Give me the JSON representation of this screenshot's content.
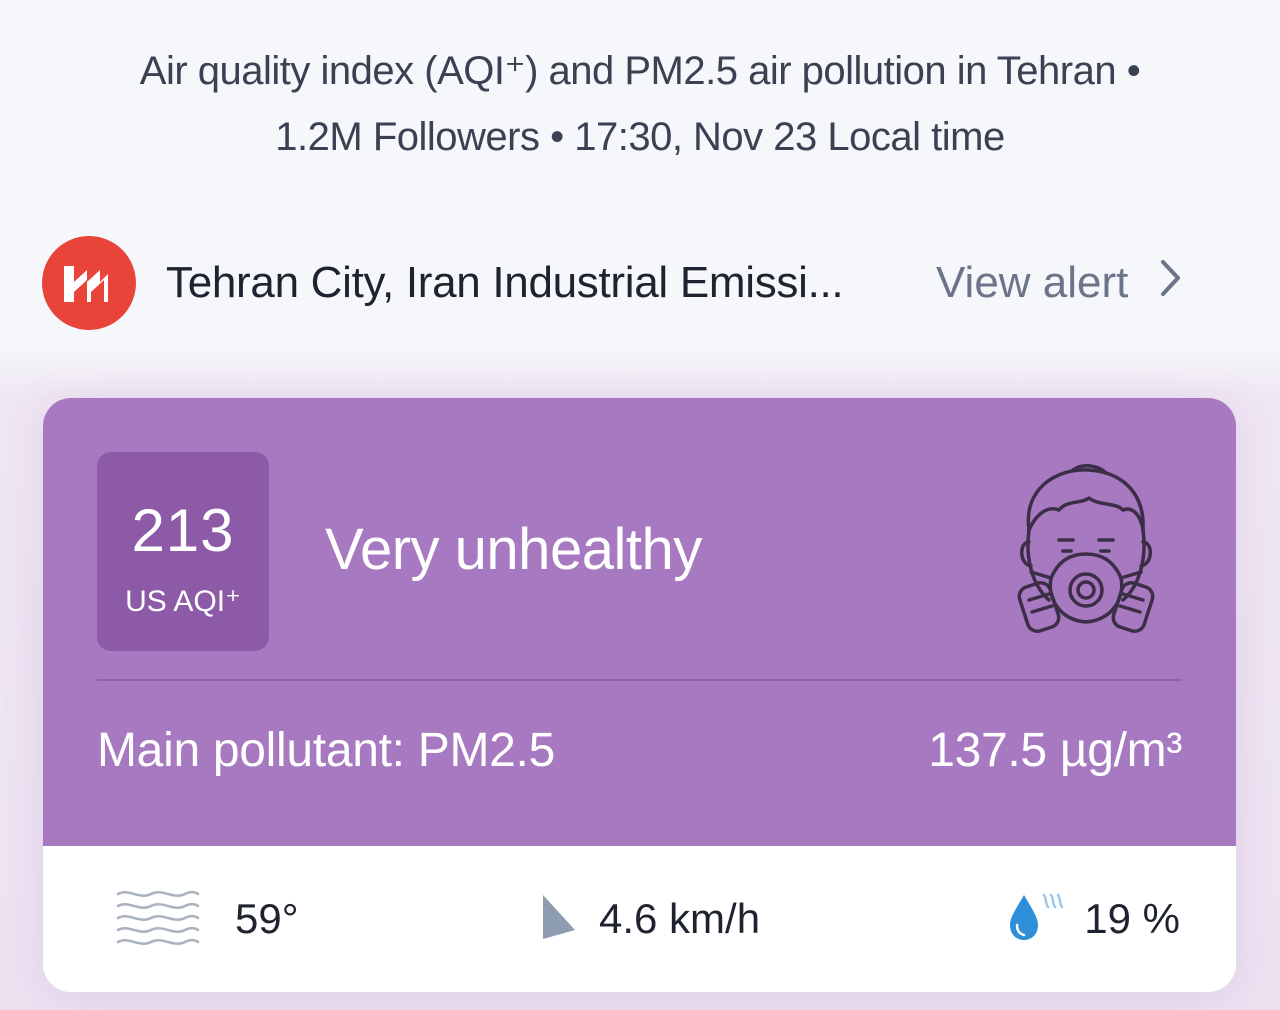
{
  "header": {
    "line1": "Air quality index (AQI⁺) and PM2.5 air pollution in Tehran •",
    "line2": "1.2M Followers • 17:30, Nov 23 Local time"
  },
  "alert": {
    "icon": "industrial-emission-icon",
    "text": "Tehran City, Iran Industrial Emissi...",
    "view_label": "View alert",
    "badge_color": "#e8443a"
  },
  "aqi": {
    "value": "213",
    "unit": "US AQI⁺",
    "status": "Very unhealthy",
    "card_color": "#a779c0",
    "box_color": "#8d5aa8",
    "icon": "gas-mask-icon"
  },
  "pollutant": {
    "label": "Main pollutant: ",
    "name": "PM2.5",
    "concentration": "137.5 µg/m³"
  },
  "weather": {
    "temperature": "59°",
    "temperature_icon": "haze-icon",
    "wind": "4.6 km/h",
    "wind_icon": "wind-direction-icon",
    "humidity": "19 %",
    "humidity_icon": "humidity-drop-icon"
  }
}
